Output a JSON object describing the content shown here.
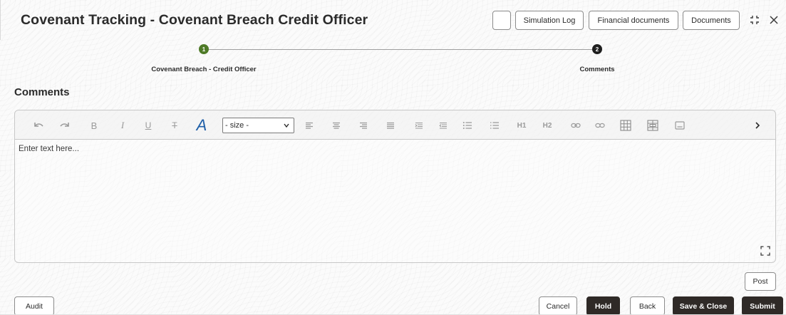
{
  "header": {
    "title": "Covenant Tracking - Covenant Breach Credit Officer",
    "buttons": {
      "simulation_log": "Simulation Log",
      "financial_documents": "Financial documents",
      "documents": "Documents"
    },
    "icons": {
      "minimize": "minimize-icon",
      "close": "close-icon"
    }
  },
  "stepper": {
    "steps": [
      {
        "number": "1",
        "label": "Covenant Breach - Credit Officer",
        "state": "completed",
        "color": "#4e7a27"
      },
      {
        "number": "2",
        "label": "Comments",
        "state": "current",
        "color": "#1f1f1f"
      }
    ]
  },
  "section": {
    "title": "Comments"
  },
  "editor": {
    "toolbar": {
      "icons": [
        "undo-icon",
        "redo-icon",
        "bold-icon",
        "italic-icon",
        "underline-icon",
        "strikethrough-icon",
        "font-color-icon",
        "align-left-icon",
        "align-center-icon",
        "align-right-icon",
        "align-justify-icon",
        "indent-icon",
        "outdent-icon",
        "bullet-list-icon",
        "numbered-list-icon",
        "heading-1-icon",
        "heading-2-icon",
        "link-icon",
        "unlink-icon",
        "table-icon",
        "table-edit-icon",
        "image-icon",
        "more-icon"
      ],
      "bold": "B",
      "italic": "I",
      "underline": "U",
      "strike": "T",
      "font_color": "A",
      "h1": "H1",
      "h2": "H2",
      "size_value": "- size -"
    },
    "placeholder": "Enter text here...",
    "expand_icon": "expand-icon"
  },
  "actions": {
    "post": "Post",
    "audit": "Audit",
    "cancel": "Cancel",
    "hold": "Hold",
    "back": "Back",
    "save_close": "Save & Close",
    "submit": "Submit"
  },
  "colors": {
    "accent_dark": "#2f2a27",
    "step_done": "#4e7a27",
    "step_current": "#1f1f1f"
  }
}
